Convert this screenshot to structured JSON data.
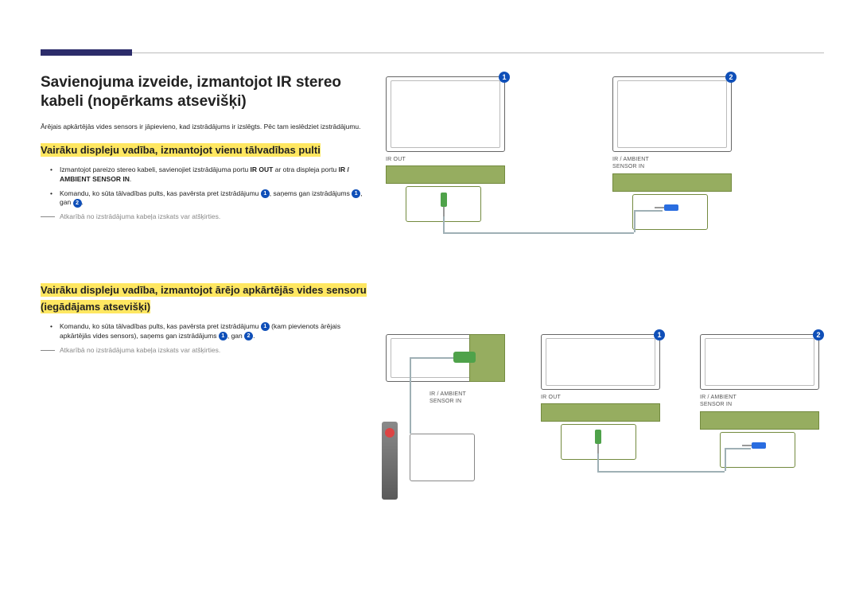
{
  "title": "Savienojuma izveide, izmantojot IR stereo kabeli (nopērkams atsevišķi)",
  "intro": "Ārējais apkārtējās vides sensors ir jāpievieno, kad izstrādājums ir izslēgts. Pēc tam ieslēdziet izstrādājumu.",
  "section1": {
    "heading": "Vairāku displeju vadība, izmantojot vienu tālvadības pulti",
    "bullet1_pre": "Izmantojot pareizo stereo kabeli, savienojiet izstrādājuma portu ",
    "bullet1_bold1": "IR OUT",
    "bullet1_mid": " ar otra displeja portu ",
    "bullet1_bold2": "IR / AMBIENT SENSOR IN",
    "bullet1_post": ".",
    "bullet2_pre": "Komandu, ko sūta tālvadības pults, kas pavērsta pret izstrādājumu ",
    "bullet2_mid1": ", saņems gan izstrādājums ",
    "bullet2_mid2": ", gan ",
    "bullet2_post": ".",
    "note": "Atkarībā no izstrādājuma kabeļa izskats var atšķirties."
  },
  "section2": {
    "heading": "Vairāku displeju vadība, izmantojot ārējo apkārtējās vides sensoru (iegādājams atsevišķi)",
    "bullet_pre": "Komandu, ko sūta tālvadības pults, kas pavērsta pret izstrādājumu ",
    "bullet_mid1": " (kam pievienots ārējais apkārtējās vides sensors), saņems gan izstrādājums ",
    "bullet_mid2": ", gan ",
    "bullet_post": ".",
    "note": "Atkarībā no izstrādājuma kabeļa izskats var atšķirties."
  },
  "labels": {
    "ir_out": "IR OUT",
    "ir_ambient": "IR / AMBIENT",
    "sensor_in": "SENSOR IN"
  },
  "nums": {
    "one": "1",
    "two": "2"
  }
}
